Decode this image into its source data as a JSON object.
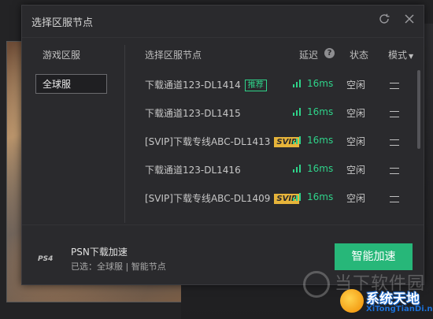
{
  "dialog": {
    "title": "选择区服节点",
    "icons": {
      "refresh": "refresh-icon",
      "close": "close-icon"
    }
  },
  "left": {
    "column_title": "游戏区服",
    "selected_region": "全球服"
  },
  "table": {
    "headers": {
      "node": "选择区服节点",
      "latency": "延迟",
      "help": "?",
      "status": "状态",
      "mode": "模式"
    },
    "rows": [
      {
        "name": "下载通道123-DL1414",
        "tag": "推荐",
        "latency": "16ms",
        "status": "空闲",
        "mode": "二"
      },
      {
        "name": "下载通道123-DL1415",
        "tag": "",
        "latency": "16ms",
        "status": "空闲",
        "mode": "二"
      },
      {
        "name": "[SVIP]下载专线ABC-DL1413",
        "tag": "SVIP",
        "latency": "16ms",
        "status": "空闲",
        "mode": "二"
      },
      {
        "name": "下载通道123-DL1416",
        "tag": "",
        "latency": "16ms",
        "status": "空闲",
        "mode": "二"
      },
      {
        "name": "[SVIP]下载专线ABC-DL1409",
        "tag": "SVIP",
        "latency": "16ms",
        "status": "空闲",
        "mode": "二"
      }
    ]
  },
  "footer": {
    "platform_logo": "PS4",
    "title": "PSN下载加速",
    "subtitle": "已选：全球服 | 智能节点",
    "button": "智能加速"
  },
  "watermarks": {
    "line1": "当下软件园",
    "site_name": "系统天地",
    "site_url": "XiTongTianDi.net"
  },
  "colors": {
    "accent_green": "#27b779",
    "latency_green": "#2fd38a",
    "svip_gold": "#e7b43a"
  }
}
